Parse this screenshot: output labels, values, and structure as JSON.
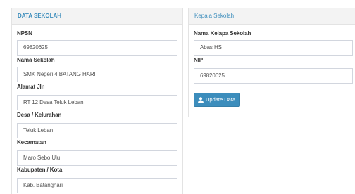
{
  "school_panel": {
    "title": "DATA SEKOLAH",
    "fields": [
      {
        "label": "NPSN",
        "value": "69820625"
      },
      {
        "label": "Nama Sekolah",
        "value": "SMK Negeri 4 BATANG HARI"
      },
      {
        "label": "Alamat Jln",
        "value": "RT 12 Desa Teluk Leban"
      },
      {
        "label": "Desa / Kelurahan",
        "value": "Teluk Leban"
      },
      {
        "label": "Kecamatan",
        "value": "Maro Sebo Ulu"
      },
      {
        "label": "Kabupaten / Kota",
        "value": "Kab. Batanghari"
      }
    ]
  },
  "head_panel": {
    "title": "Kepala Sekolah",
    "fields": [
      {
        "label": "Nama Kelapa Sekolah",
        "value": "Abas HS"
      },
      {
        "label": "NIP",
        "value": "69820625"
      }
    ],
    "update_button_label": "Update Data",
    "update_button_icon": "user-icon"
  },
  "colors": {
    "accent": "#3c8dbc",
    "panel_header_bg": "#f3f3f3",
    "border": "#e3e3e3"
  }
}
